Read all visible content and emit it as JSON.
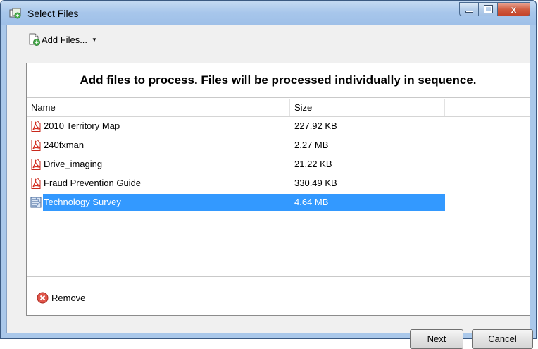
{
  "window": {
    "title": "Select Files",
    "controls": {
      "minimize": "",
      "maximize": "",
      "close": "x"
    }
  },
  "toolbar": {
    "add_files_label": "Add Files...",
    "add_files_caret": "▼"
  },
  "panel": {
    "headline": "Add files to process. Files will be processed individually in sequence.",
    "columns": [
      "Name",
      "Size",
      ""
    ],
    "rows": [
      {
        "name": "2010 Territory Map",
        "size": "227.92 KB",
        "icon": "pdf-icon",
        "selected": false
      },
      {
        "name": "240fxman",
        "size": "2.27 MB",
        "icon": "pdf-icon",
        "selected": false
      },
      {
        "name": "Drive_imaging",
        "size": "21.22 KB",
        "icon": "pdf-icon",
        "selected": false
      },
      {
        "name": "Fraud Prevention Guide",
        "size": "330.49 KB",
        "icon": "pdf-icon",
        "selected": false
      },
      {
        "name": "Technology Survey",
        "size": "4.64 MB",
        "icon": "document-icon",
        "selected": true
      }
    ],
    "remove_label": "Remove"
  },
  "buttons": {
    "next": "Next",
    "cancel": "Cancel"
  },
  "colors": {
    "selection": "#3399ff",
    "pdf_red": "#d42b1e"
  }
}
